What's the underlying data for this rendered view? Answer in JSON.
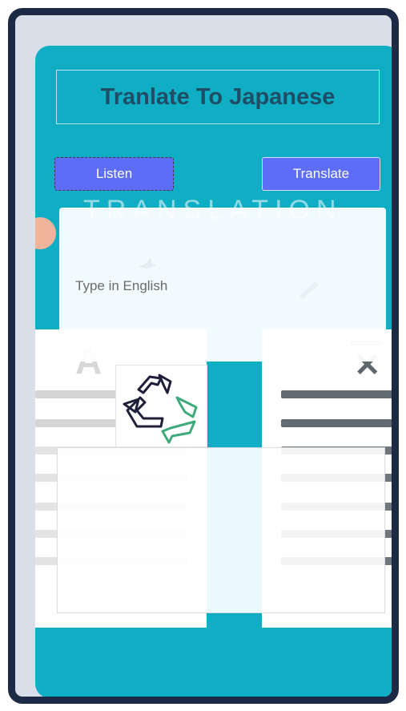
{
  "header": {
    "title": "Tranlate To Japanese"
  },
  "buttons": {
    "listen_label": "Listen",
    "translate_label": "Translate"
  },
  "input": {
    "placeholder": "Type in English",
    "value": ""
  },
  "background": {
    "watermark_text": "TRANSLATION",
    "letter_a": "A",
    "letter_x": "✕"
  },
  "colors": {
    "frame": "#1d2a46",
    "card": "#10aec4",
    "button": "#5d6df7",
    "title_text": "#1f4d66"
  },
  "icons": {
    "swap": "recycle-icon"
  }
}
